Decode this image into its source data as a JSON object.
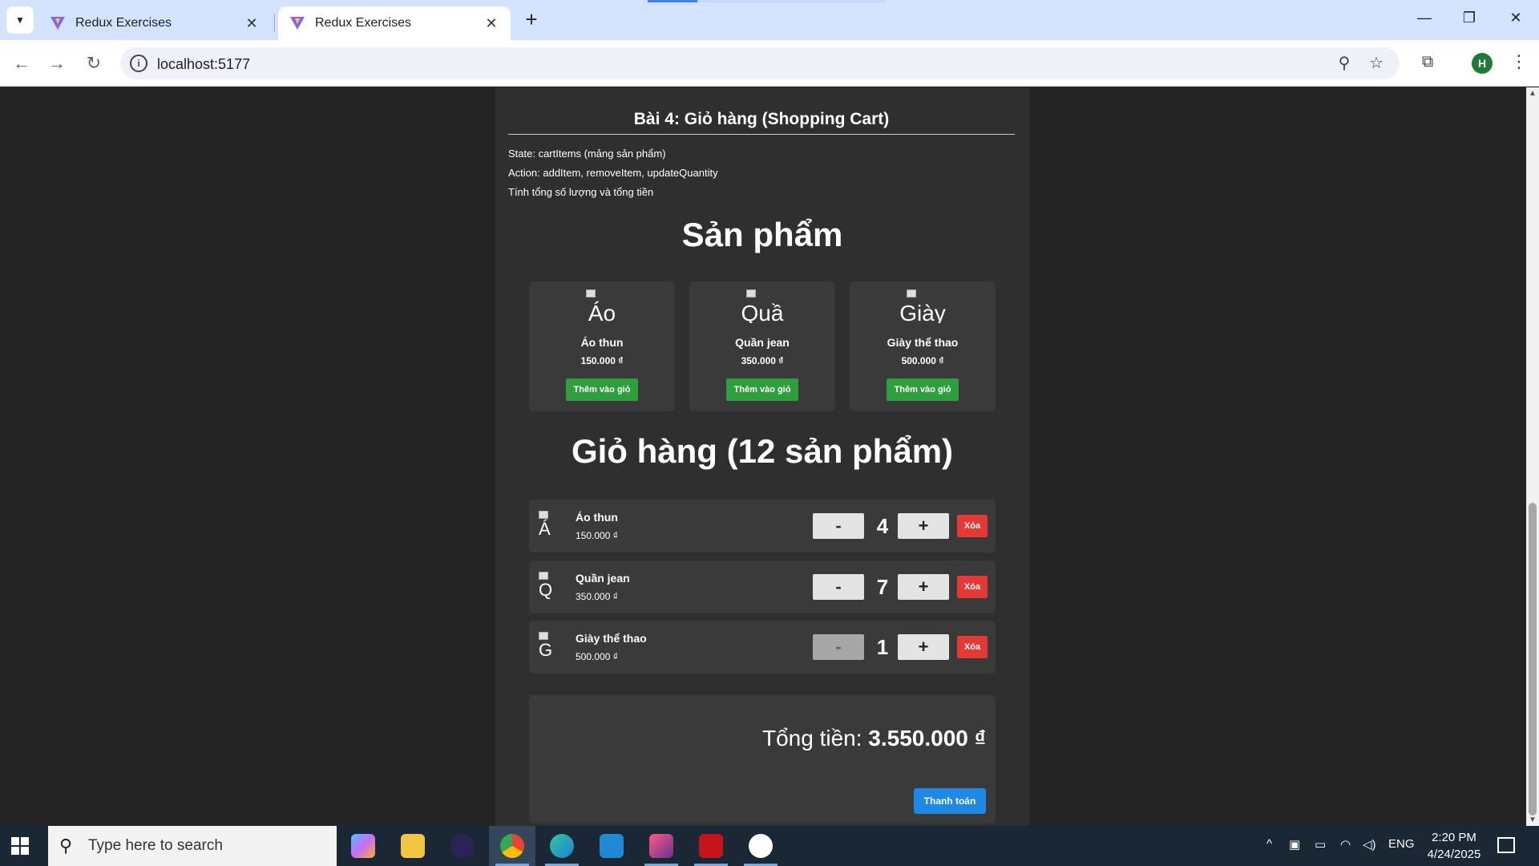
{
  "browser": {
    "tabs": [
      {
        "title": "Redux Exercises",
        "active": false
      },
      {
        "title": "Redux Exercises",
        "active": true
      }
    ],
    "url": "localhost:5177",
    "profile_initial": "H",
    "accent_color": "#d3e3fd"
  },
  "page": {
    "exercise_title": "Bài 4: Giỏ hàng (Shopping Cart)",
    "description": [
      "State: cartItems (mảng sản phẩm)",
      "Action: addItem, removeItem, updateQuantity",
      "Tính tổng số lượng và tổng tiền"
    ],
    "products_heading": "Sản phẩm",
    "products": [
      {
        "img_alt": "Áo",
        "name": "Áo thun",
        "price": "150.000 ₫",
        "add_label": "Thêm vào giỏ"
      },
      {
        "img_alt": "Quầ",
        "name": "Quần jean",
        "price": "350.000 ₫",
        "add_label": "Thêm vào giỏ"
      },
      {
        "img_alt": "Giày",
        "name": "Giày thể thao",
        "price": "500.000 ₫",
        "add_label": "Thêm vào giỏ"
      }
    ],
    "cart_heading": "Giỏ hàng (12 sản phẩm)",
    "cart_items": [
      {
        "img_alt": "Á",
        "name": "Áo thun",
        "price": "150.000 ₫",
        "qty": "4",
        "minus": "-",
        "plus": "+",
        "remove": "Xóa",
        "minus_disabled": false
      },
      {
        "img_alt": "Q",
        "name": "Quần jean",
        "price": "350.000 ₫",
        "qty": "7",
        "minus": "-",
        "plus": "+",
        "remove": "Xóa",
        "minus_disabled": false
      },
      {
        "img_alt": "G",
        "name": "Giày thể thao",
        "price": "500.000 ₫",
        "qty": "1",
        "minus": "-",
        "plus": "+",
        "remove": "Xóa",
        "minus_disabled": true
      }
    ],
    "total_label": "Tổng tiền:",
    "total_value": "3.550.000 ₫",
    "checkout_label": "Thanh toán",
    "colors": {
      "add_button": "#2e9e3e",
      "remove_button": "#e53935",
      "checkout_button": "#1e88e5"
    }
  },
  "taskbar": {
    "search_placeholder": "Type here to search",
    "language": "ENG",
    "time": "2:20 PM",
    "date": "4/24/2025",
    "apps": [
      "copilot-icon",
      "file-explorer-icon",
      "eclipse-icon",
      "chrome-icon",
      "edge-icon",
      "vscode-icon",
      "intellij-icon",
      "garena-icon",
      "zalo-icon"
    ]
  }
}
